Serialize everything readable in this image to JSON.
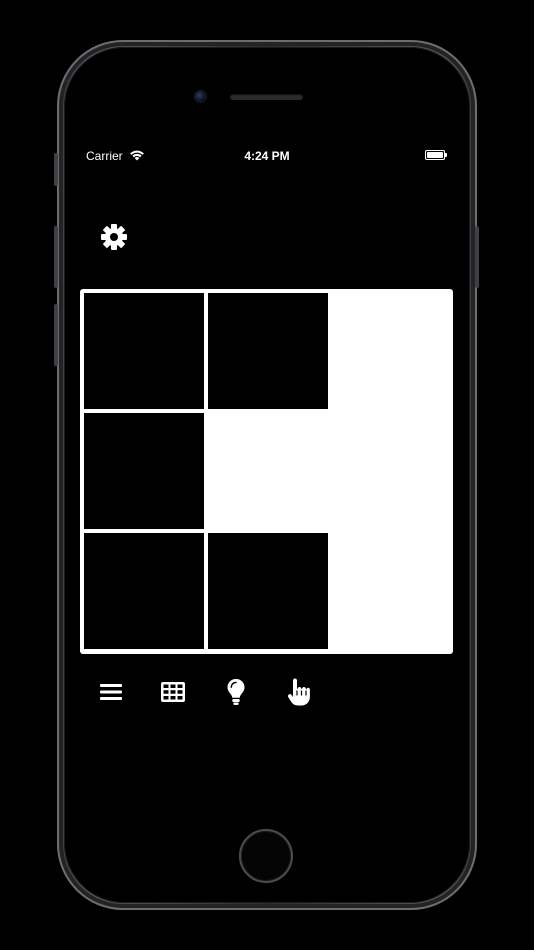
{
  "status_bar": {
    "carrier": "Carrier",
    "time": "4:24 PM"
  },
  "colors": {
    "background": "#000000",
    "board": "#ffffff",
    "tile": "#000000",
    "icon": "#ffffff"
  },
  "board": {
    "rows": 3,
    "cols": 3,
    "cells": [
      [
        1,
        1,
        0
      ],
      [
        1,
        0,
        0
      ],
      [
        1,
        1,
        0
      ]
    ]
  },
  "icons": {
    "settings": "gear-icon",
    "toolbar": [
      "menu-icon",
      "grid-icon",
      "lightbulb-icon",
      "hand-pointer-icon"
    ]
  }
}
